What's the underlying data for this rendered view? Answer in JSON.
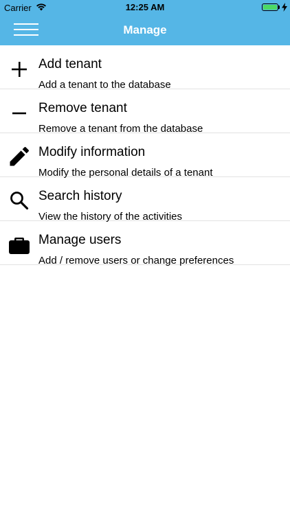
{
  "status_bar": {
    "carrier": "Carrier",
    "time": "12:25 AM",
    "battery_level": 1.0
  },
  "navbar": {
    "title": "Manage",
    "menu_icon": "hamburger-menu-icon",
    "background_color": "#55b6e6"
  },
  "menu": {
    "items": [
      {
        "icon": "plus-icon",
        "title": "Add tenant",
        "subtitle": "Add a tenant to the database"
      },
      {
        "icon": "minus-icon",
        "title": "Remove tenant",
        "subtitle": "Remove a tenant from the database"
      },
      {
        "icon": "pencil-icon",
        "title": "Modify information",
        "subtitle": "Modify the personal details of a tenant"
      },
      {
        "icon": "search-icon",
        "title": "Search history",
        "subtitle": "View the history of the activities"
      },
      {
        "icon": "briefcase-icon",
        "title": "Manage users",
        "subtitle": "Add / remove users or change preferences"
      }
    ]
  }
}
